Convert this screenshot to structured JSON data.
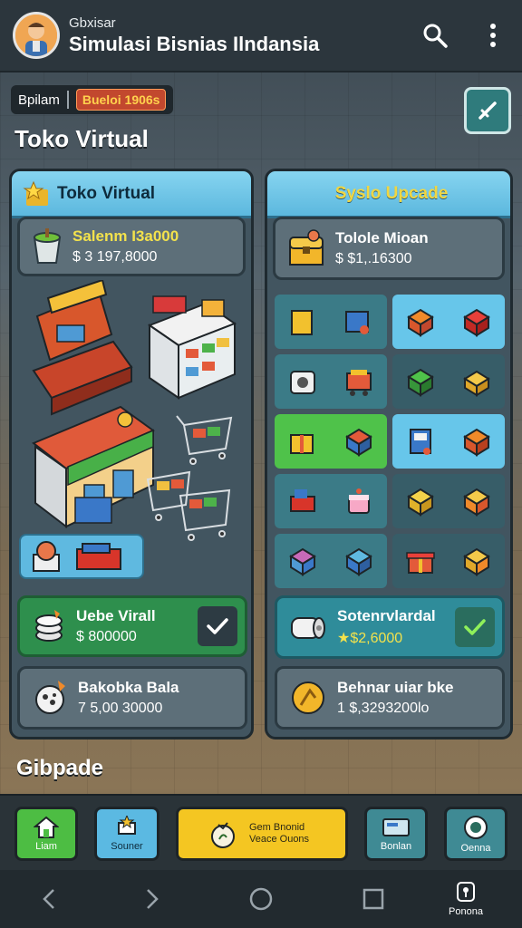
{
  "appbar": {
    "subtitle": "Gbxisar",
    "title": "Simulasi Bisnias Ilndansia",
    "icons": [
      "avatar",
      "search-icon",
      "more-vertical-icon"
    ]
  },
  "header": {
    "pill_label": "Bpilam",
    "pill_badge": "Bueloi 1906s",
    "page_title": "Toko Virtual"
  },
  "left_panel": {
    "title": "Toko Virtual",
    "top_card": {
      "name": "Salenm I3a000",
      "value": "$ 3 197,8000"
    },
    "owned_card": {
      "name": "Uebe Virall",
      "value": "$ 800000"
    },
    "bottom_card": {
      "name": "Bakobka Bala",
      "value": "7 5,00 30000"
    }
  },
  "right_panel": {
    "title": "Syslo Upcade",
    "top_card": {
      "name": "Tolole Mioan",
      "value": "$ $1,.16300"
    },
    "owned_card": {
      "name": "Sotenrvlardal",
      "value": "$2,6000"
    },
    "bottom_card": {
      "name": "Behnar uiar bke",
      "value": "1 $,3293200lo"
    }
  },
  "section_label": "Gibpade",
  "game_nav": {
    "home": "Liam",
    "scores": "Souner",
    "main_line1": "Gem Bnonid",
    "main_line2": "Veace Ouons",
    "bank": "Bonlan",
    "other": "Oenna"
  },
  "system_nav": {
    "profile_label": "Ponona"
  },
  "colors": {
    "appbar": "#2c363d",
    "panel_head": "#5cb8de",
    "accent_yellow": "#f3e24c",
    "owned_green": "#2e8f4d",
    "owned_teal": "#2f8c9a",
    "main_button": "#f4c622"
  }
}
